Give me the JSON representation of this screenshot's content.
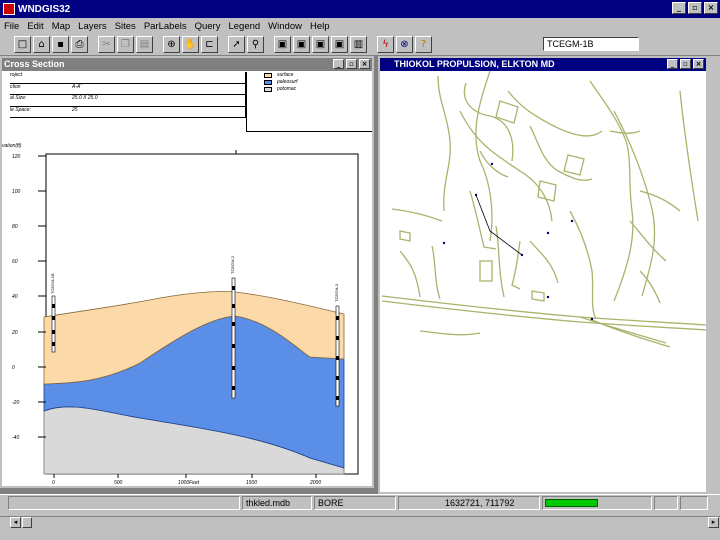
{
  "app": {
    "title": "WNDGIS32"
  },
  "menu": [
    "File",
    "Edit",
    "Map",
    "Layers",
    "Sites",
    "ParLabels",
    "Query",
    "Legend",
    "Window",
    "Help"
  ],
  "toolbar": {
    "icons": [
      "new-icon",
      "open-icon",
      "save-icon",
      "print-icon",
      "cut-icon",
      "copy-icon",
      "paste-icon",
      "zoom-icon",
      "pan-icon",
      "layer-icon",
      "pointer-icon",
      "find-icon",
      "grid-icon",
      "grid2-icon",
      "grid3-icon",
      "grid4-icon",
      "chart-icon",
      "lightning-icon",
      "stop-icon",
      "help-icon"
    ],
    "layer_value": "TCEGM-1B"
  },
  "cross_section": {
    "title": "Cross Section",
    "info_rows": [
      {
        "label": "roject",
        "value": ""
      },
      {
        "label": "ction",
        "value": "A-A'"
      },
      {
        "label": "al Size:",
        "value": "25.0 X 25.0"
      },
      {
        "label": "le Space:",
        "value": "25"
      }
    ],
    "legend": [
      {
        "label": "surface",
        "color": "#fcd9a8"
      },
      {
        "label": "paleosurf",
        "color": "#5b8ee6"
      },
      {
        "label": "potomac",
        "color": "#d9d9d9"
      }
    ],
    "ylabel": "vation(ft)",
    "yticks": [
      "120",
      "100",
      "80",
      "60",
      "40",
      "20",
      "0",
      "-20",
      "-40"
    ],
    "xticks": [
      "0",
      "500",
      "1000Feet",
      "1500",
      "2000"
    ],
    "wells": [
      "TCEGM-1B",
      "TCEGM-2",
      "TCEGM-3"
    ]
  },
  "map": {
    "title": "THIOKOL PROPULSION, ELKTON MD",
    "line_color": "#a8b46c"
  },
  "status": {
    "empty": "",
    "db": "thkled.mdb",
    "mode": "BORE",
    "coords": "1632721, 711792",
    "progress": 1.0,
    "progress_color": "#00c800"
  }
}
